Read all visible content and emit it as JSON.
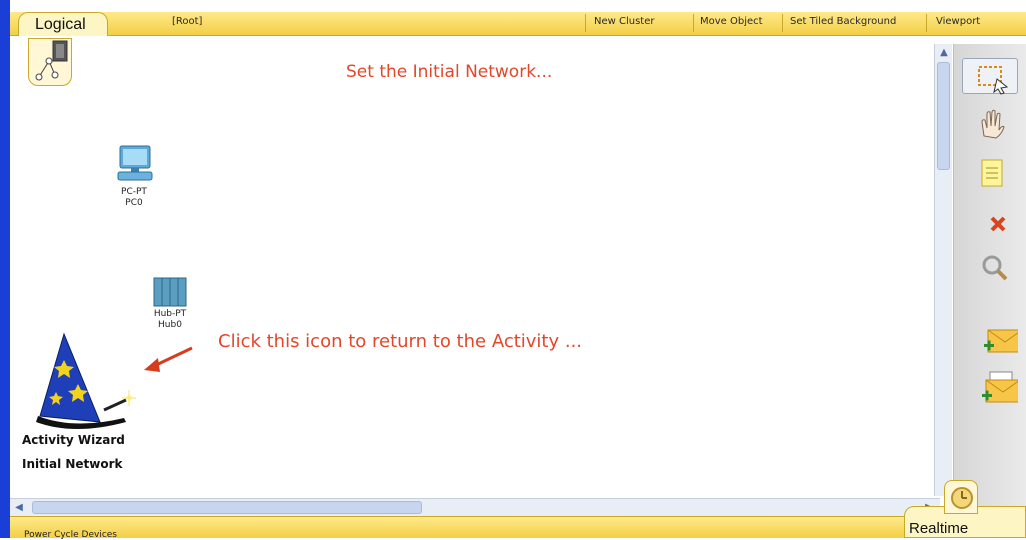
{
  "workspace": {
    "logical_tab_label": "Logical",
    "root_label": "[Root]",
    "menu": [
      "New Cluster",
      "Move Object",
      "Set Tiled Background",
      "Viewport"
    ]
  },
  "canvas": {
    "title": "Set the Initial Network...",
    "note": "Click this icon to return to the Activity ...",
    "devices": {
      "pc": {
        "model": "PC-PT",
        "name": "PC0"
      },
      "hub": {
        "model": "Hub-PT",
        "name": "Hub0"
      },
      "wizard": {
        "line1": "Activity Wizard",
        "line2": "Initial Network"
      }
    }
  },
  "toolbox": {
    "tools": [
      "select-icon",
      "hand-icon",
      "note-icon",
      "delete-icon",
      "zoom-icon",
      "add-simple-pdu-icon",
      "add-complex-pdu-icon"
    ],
    "selected": "select-icon"
  },
  "status": {
    "text": "Power Cycle Devices",
    "mode_label": "Realtime"
  },
  "colors": {
    "accent_text": "#e2472b",
    "bar_yellow": "#f3cf45",
    "left_stripe": "#1a3fd6"
  }
}
